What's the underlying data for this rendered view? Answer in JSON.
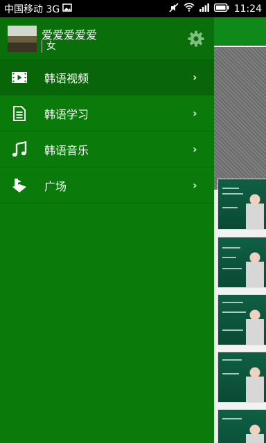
{
  "status_bar": {
    "carrier": "中国移动 3G",
    "time": "11:24"
  },
  "profile": {
    "username": "爱爱爱爱爱",
    "gender": "女"
  },
  "menu": {
    "items": [
      {
        "label": "韩语视频",
        "icon": "video-icon"
      },
      {
        "label": "韩语学习",
        "icon": "document-icon"
      },
      {
        "label": "韩语音乐",
        "icon": "music-icon"
      },
      {
        "label": "广场",
        "icon": "square-icon"
      }
    ]
  },
  "colors": {
    "drawer_bg": "#0a7a0a",
    "active_item_bg": "#086508",
    "status_bar_bg": "#000000"
  }
}
